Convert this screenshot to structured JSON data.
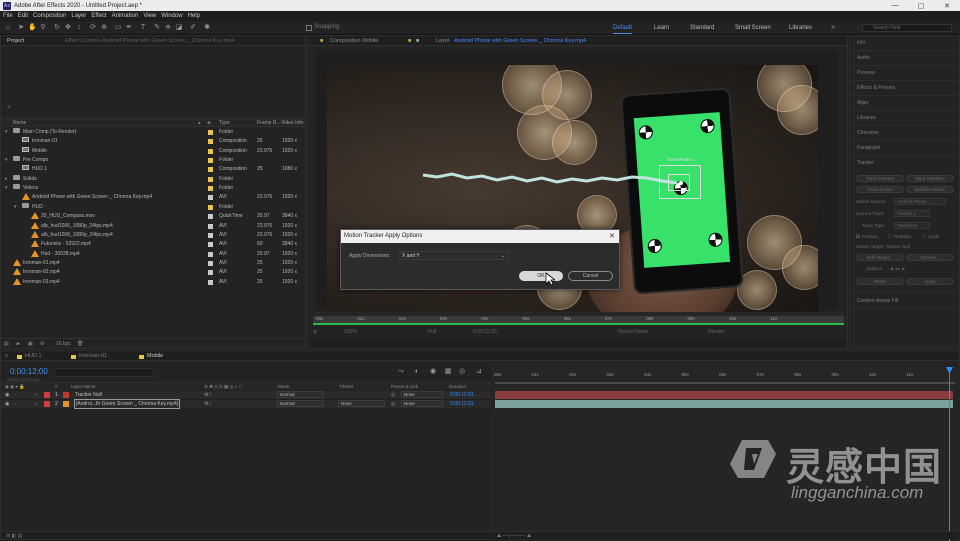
{
  "window": {
    "title": "Adobe After Effects 2020 - Untitled Project.aep *",
    "app_badge": "Ae",
    "btn_min": "—",
    "btn_max": "▢",
    "btn_close": "✕"
  },
  "menu": [
    "File",
    "Edit",
    "Composition",
    "Layer",
    "Effect",
    "Animation",
    "View",
    "Window",
    "Help"
  ],
  "toolbar": {
    "snapping_label": "Snapping"
  },
  "workspaces": [
    {
      "label": "Default",
      "active": true
    },
    {
      "label": "Learn",
      "active": false
    },
    {
      "label": "Standard",
      "active": false
    },
    {
      "label": "Small Screen",
      "active": false
    },
    {
      "label": "Libraries",
      "active": false
    }
  ],
  "search_help": {
    "placeholder": "Search Help"
  },
  "project": {
    "tab_label": "Project",
    "effect_controls_tab": "Effect Controls Android Phone with Green Screen _ Chroma Key.mp4",
    "columns": {
      "name": "Name",
      "type": "Type",
      "frame_rate": "Frame R...",
      "video_info": "Video Info"
    },
    "items": [
      {
        "indent": 0,
        "kind": "folder",
        "expand": "▾",
        "name": "Main Comp (To Render)",
        "label_color": "#e6c84a",
        "type": "Folder",
        "fps": "",
        "info": ""
      },
      {
        "indent": 1,
        "kind": "comp",
        "expand": "",
        "name": "Ironman-01",
        "label_color": "#e6c84a",
        "type": "Composition",
        "fps": "25",
        "info": "1920 x"
      },
      {
        "indent": 1,
        "kind": "comp",
        "expand": "",
        "name": "Mobile",
        "label_color": "#e6c84a",
        "type": "Composition",
        "fps": "23.976",
        "info": "1920 x"
      },
      {
        "indent": 0,
        "kind": "folder",
        "expand": "▾",
        "name": "Pre Comps",
        "label_color": "#e6c84a",
        "type": "Folder",
        "fps": "",
        "info": ""
      },
      {
        "indent": 1,
        "kind": "comp",
        "expand": "",
        "name": "HUD 1",
        "label_color": "#e6c84a",
        "type": "Composition",
        "fps": "25",
        "info": "1080 x"
      },
      {
        "indent": 0,
        "kind": "folder",
        "expand": "▸",
        "name": "Solids",
        "label_color": "#e6c84a",
        "type": "Folder",
        "fps": "",
        "info": ""
      },
      {
        "indent": 0,
        "kind": "folder",
        "expand": "▾",
        "name": "Videos",
        "label_color": "#e6c84a",
        "type": "Folder",
        "fps": "",
        "info": ""
      },
      {
        "indent": 1,
        "kind": "avi",
        "expand": "",
        "name": "Android Phone with Green Screen _ Chroma Key.mp4",
        "label_color": "#c9c9c9",
        "type": "AVI",
        "fps": "23.976",
        "info": "1920 x"
      },
      {
        "indent": 1,
        "kind": "folder",
        "expand": "▾",
        "name": "HUD",
        "label_color": "#e6c84a",
        "type": "Folder",
        "fps": "",
        "info": ""
      },
      {
        "indent": 2,
        "kind": "avi",
        "expand": "",
        "name": "29_HUD_Compass.mov",
        "label_color": "#c9c9c9",
        "type": "QuickTime",
        "fps": "29.97",
        "info": "3840 x"
      },
      {
        "indent": 2,
        "kind": "avi",
        "expand": "",
        "name": "alb_hud1006_1080p_24fps.mp4",
        "label_color": "#c9c9c9",
        "type": "AVI",
        "fps": "23.976",
        "info": "1920 x"
      },
      {
        "indent": 2,
        "kind": "avi",
        "expand": "",
        "name": "alb_hud1008_1080p_24fps.mp4",
        "label_color": "#c9c9c9",
        "type": "AVI",
        "fps": "23.976",
        "info": "1920 x"
      },
      {
        "indent": 2,
        "kind": "avi",
        "expand": "",
        "name": "Futuristic - 52922.mp4",
        "label_color": "#c9c9c9",
        "type": "AVI",
        "fps": "60",
        "info": "3840 x"
      },
      {
        "indent": 2,
        "kind": "avi",
        "expand": "",
        "name": "Hud - 30038.mp4",
        "label_color": "#c9c9c9",
        "type": "AVI",
        "fps": "29.97",
        "info": "1920 x"
      },
      {
        "indent": 0,
        "kind": "avi",
        "expand": "",
        "name": "Ironman-01.mp4",
        "label_color": "#c9c9c9",
        "type": "AVI",
        "fps": "25",
        "info": "1920 x"
      },
      {
        "indent": 0,
        "kind": "avi",
        "expand": "",
        "name": "Ironman-02.mp4",
        "label_color": "#c9c9c9",
        "type": "AVI",
        "fps": "25",
        "info": "1920 x"
      },
      {
        "indent": 0,
        "kind": "avi",
        "expand": "",
        "name": "Ironman-03.mp4",
        "label_color": "#c9c9c9",
        "type": "AVI",
        "fps": "25",
        "info": "1920 x"
      }
    ],
    "bpc": "16 bpc"
  },
  "viewer": {
    "comp_tab": "Composition Mobile",
    "layer_tab_prefix": "Layer",
    "layer_tab": "Android Phone with Green Screen _ Chroma Key.mp4",
    "track_point_label": "Track Point 1",
    "ruler_ticks": [
      "00s",
      "01s",
      "02s",
      "03s",
      "04s",
      "05s",
      "06s",
      "07s",
      "08s",
      "09s",
      "10s",
      "11s"
    ],
    "controls": [
      "100%",
      "Full",
      "0:00:12:00",
      "Source Name",
      "Render"
    ]
  },
  "dialog": {
    "title": "Motion Tracker Apply Options",
    "close": "✕",
    "label": "Apply Dimensions:",
    "value": "X and Y",
    "ok": "OK",
    "cancel": "Cancel"
  },
  "right_panel": {
    "items": [
      "Info",
      "Audio",
      "Preview",
      "Effects & Presets",
      "Align",
      "Libraries",
      "Character",
      "Paragraph",
      "Tracker"
    ],
    "tracker": {
      "btn_track_camera": "Track Camera",
      "btn_warp": "Warp Stabilizer",
      "btn_track_motion": "Track Motion",
      "btn_stabilize": "Stabilize Motion",
      "motion_source_label": "Motion Source:",
      "motion_source": "Android Phone...",
      "current_track_label": "Current Track:",
      "current_track": "Tracker 1",
      "track_type_label": "Track Type:",
      "track_type": "Transform",
      "position": "Position",
      "rotation": "Rotation",
      "scale": "Scale",
      "motion_target": "Motion Target: Tracker Null",
      "edit_target": "Edit Target...",
      "options": "Options...",
      "analyze": "Analyze:",
      "reset": "Reset",
      "apply": "Apply"
    },
    "content_aware": "Content-Aware Fill"
  },
  "timeline": {
    "tabs": [
      {
        "label": "HUD 1",
        "color": "#e6c84a"
      },
      {
        "label": "Ironman-01",
        "color": "#e6c84a"
      },
      {
        "label": "Mobile",
        "color": "#e6c84a"
      }
    ],
    "timecode": "0:00:12:00",
    "timecode_sub": "00288 (23.976 fps)",
    "col_source": "#",
    "col_layer_name": "Layer Name",
    "col_mode": "Mode",
    "col_trkmat": "TrkMat",
    "col_parent": "Parent & Link",
    "col_duration": "Duration",
    "ruler_ticks": [
      "00s",
      "01s",
      "02s",
      "03s",
      "04s",
      "05s",
      "06s",
      "07s",
      "08s",
      "09s",
      "10s",
      "11s"
    ],
    "layers": [
      {
        "num": "1",
        "name": "Tracker Null",
        "label_color": "#d43b3b",
        "mode": "Normal",
        "trkmat": "",
        "parent": "None",
        "duration": "0:00:12:01",
        "bar_color": "#8a3b3e"
      },
      {
        "num": "2",
        "name": "[Androi...th Green Screen _ Chroma Key.mp4]",
        "label_color": "#d43b3b",
        "mode": "Normal",
        "trkmat": "None",
        "parent": "None",
        "duration": "0:00:12:01",
        "bar_color": "#7aa19b"
      }
    ]
  },
  "watermark": {
    "cn": "灵感中国",
    "url": "lingganchina.com"
  }
}
